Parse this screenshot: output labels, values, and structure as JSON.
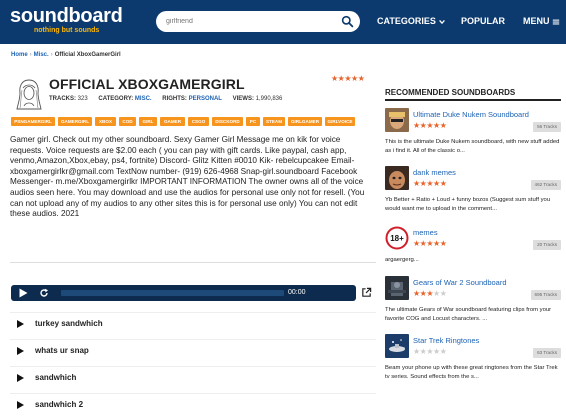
{
  "header": {
    "logo_main": "soundboard",
    "logo_tag": "nothing but sounds",
    "search_placeholder": "girlfriend",
    "nav": {
      "categories": "CATEGORIES",
      "popular": "POPULAR",
      "menu": "MENU"
    }
  },
  "breadcrumb": {
    "home": "Home",
    "misc": "Misc.",
    "current": "Official XboxGamerGirl"
  },
  "board": {
    "title": "OFFICIAL XBOXGAMERGIRL",
    "rating_stars": 5,
    "tracks_label": "TRACKS:",
    "tracks_value": "323",
    "category_label": "CATEGORY:",
    "category_value": "MISC.",
    "rights_label": "RIGHTS:",
    "rights_value": "PERSONAL",
    "views_label": "VIEWS:",
    "views_value": "1,990,836",
    "tags": [
      "PSNGAMERGIRL",
      "GAMERGIRL",
      "XBOX",
      "COD",
      "GIRL",
      "GAMER",
      "CSGO",
      "DISCKORD",
      "PC",
      "STEAM",
      "GIRLGAMER",
      "GIRLVOICE"
    ],
    "description": "Gamer girl. Check out my other soundboard. Sexy Gamer Girl Message me on kik for voice requests. Voice requests are $2.00 each ( you can pay with gift cards. Like paypal, cash app, venmo,Amazon,Xbox,ebay, ps4, fortnite) Discord- Glitz Kitten #0010 Kik- rebelcupcakee Email- xboxgamergirlkr@gmail.com TextNow number- (919) 626-4968 Snap-girl.soundboard Facebook Messenger- m.me/Xboxgamergirlkr IMPORTANT INFORMATION The owner owns all of the voice audios seen here. You may download and use the audios for personal use only not for resell. (You can not upload any of my audios to any other sites this is for personal use only) You can not edit these audios. 2021"
  },
  "player": {
    "time": "00:00",
    "progress": 0
  },
  "sounds": [
    {
      "label": "turkey sandwhich"
    },
    {
      "label": "whats ur snap"
    },
    {
      "label": "sandwhich"
    },
    {
      "label": "sandwhich 2"
    }
  ],
  "sidebar": {
    "title": "RECOMMENDED SOUNDBOARDS",
    "items": [
      {
        "name": "Ultimate Duke Nukem Soundboard",
        "stars": 5,
        "tracks": "56 Tracks",
        "desc": "This is the ultimate Duke Nukem soundboard, with new stuff added as i find it. All of the classic o..."
      },
      {
        "name": "dank memes",
        "stars": 5,
        "tracks": "462 Tracks",
        "desc": "Yb Better + Ratio + Loud + funny bozos (Suggest sum stuff you would want me to upload in the comment..."
      },
      {
        "name": "memes",
        "stars": 5,
        "tracks": "20 Tracks",
        "desc": "argaergerg..."
      },
      {
        "name": "Gears of War 2 Soundboard",
        "stars": 3,
        "tracks": "695 Tracks",
        "desc": "The ultimate Gears of War soundboard featuring clips from your favorite COG and Locust characters. ..."
      },
      {
        "name": "Star Trek Ringtones",
        "stars": 0,
        "tracks": "63 Tracks",
        "desc": "Beam your phone up with these great ringtones from the Star Trek tv series. Sound effects from the s..."
      }
    ]
  },
  "colors": {
    "header_bg": "#0d3a6e",
    "accent_orange": "#f7941d",
    "star": "#e8632a",
    "link_blue": "#1d63b4",
    "player_bg": "#0d2b4e"
  }
}
